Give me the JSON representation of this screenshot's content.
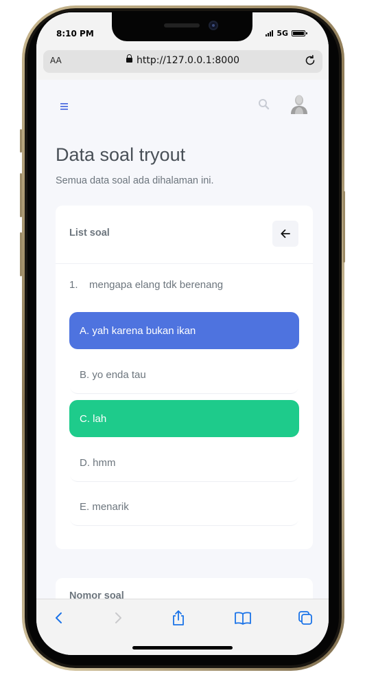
{
  "status_bar": {
    "time": "8:10 PM",
    "network": "5G"
  },
  "browser": {
    "text_size_label": "AA",
    "url": "http://127.0.0.1:8000"
  },
  "header": {
    "menu_icon": "hamburger-icon",
    "search_icon": "search-icon",
    "avatar_icon": "user-avatar-icon"
  },
  "page": {
    "title": "Data soal tryout",
    "subtitle": "Semua data soal ada dihalaman ini."
  },
  "card": {
    "title": "List soal",
    "back_icon": "arrow-left-icon",
    "question": {
      "number": "1.",
      "text": "mengapa elang tdk berenang"
    },
    "options": [
      {
        "label": "A. yah karena bukan ikan",
        "state": "selected",
        "color": "#4e73df"
      },
      {
        "label": "B. yo enda tau",
        "state": "default"
      },
      {
        "label": "C. lah",
        "state": "correct",
        "color": "#1ecb8b"
      },
      {
        "label": "D. hmm",
        "state": "default"
      },
      {
        "label": "E. menarik",
        "state": "default"
      }
    ]
  },
  "card2": {
    "title": "Nomor soal"
  },
  "toolbar": {
    "icons": [
      "back-icon",
      "forward-icon",
      "share-icon",
      "bookmarks-icon",
      "tabs-icon"
    ],
    "accent": "#1a73e8"
  },
  "colors": {
    "accent": "#4e73df",
    "success": "#1ecb8b",
    "page_bg": "#f6f7fb"
  }
}
